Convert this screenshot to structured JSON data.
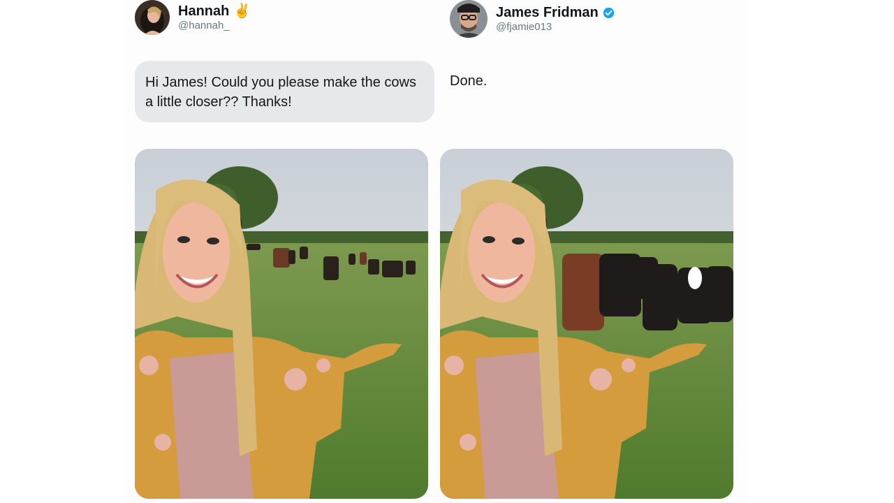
{
  "left_user": {
    "name": "Hannah",
    "emoji": "✌️",
    "handle": "@hannah_",
    "message": "Hi James! Could you please make the cows a little closer?? Thanks!"
  },
  "right_user": {
    "name": "James Fridman",
    "handle": "@fjamie013",
    "verified": true,
    "message": "Done."
  },
  "icons": {
    "verified": "verified-badge-icon"
  },
  "colors": {
    "verified_blue": "#1da1f2",
    "bubble_bg": "#e6e9ec",
    "handle_gray": "#657786"
  }
}
